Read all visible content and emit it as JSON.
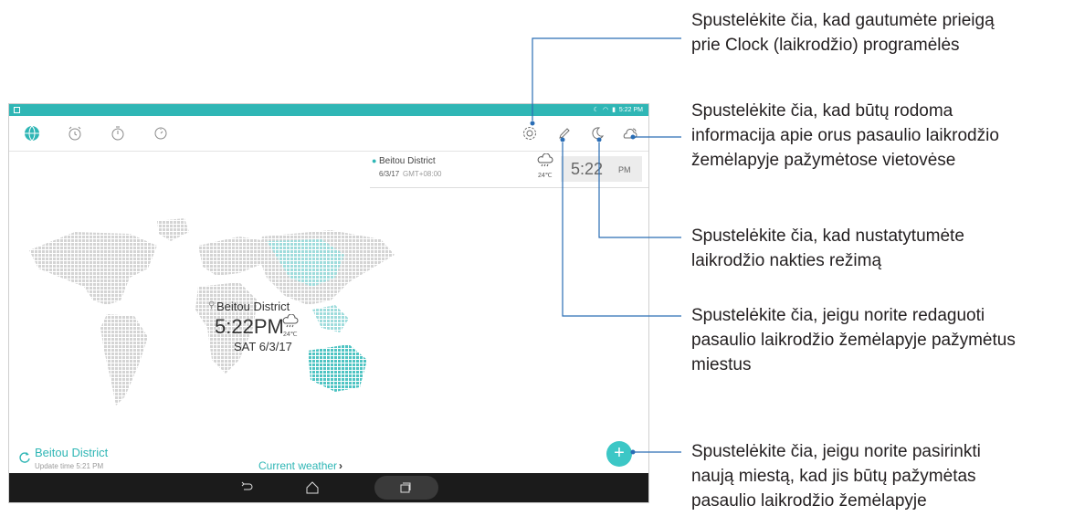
{
  "status_bar": {
    "time": "5:22 PM"
  },
  "toolbar": {
    "left_tabs": [
      "world-clock-icon",
      "alarm-icon",
      "stopwatch-icon",
      "timer-icon"
    ],
    "right_actions": [
      "settings-icon",
      "edit-icon",
      "night-mode-icon",
      "weather-icon"
    ]
  },
  "city_card": {
    "name": "Beitou District",
    "date": "6/3/17",
    "timezone": "GMT+08:00",
    "temperature": "24℃",
    "time": "5:22",
    "ampm": "PM"
  },
  "map_marker": {
    "name": "Beitou District",
    "time": "5:22PM",
    "temperature": "24℃",
    "date": "SAT 6/3/17"
  },
  "footer": {
    "location": "Beitou District",
    "update_time": "Update time 5:21 PM",
    "current_weather": "Current weather"
  },
  "callouts": {
    "settings": [
      "Spustelėkite čia, kad gautumėte prieigą",
      "prie Clock (laikrodžio) programėlės"
    ],
    "weather": [
      "Spustelėkite čia, kad būtų rodoma",
      "informacija apie orus pasaulio laikrodžio",
      "žemėlapyje pažymėtose vietovėse"
    ],
    "night_mode": [
      "Spustelėkite čia, kad nustatytumėte",
      "laikrodžio nakties režimą"
    ],
    "edit": [
      "Spustelėkite čia, jeigu norite redaguoti",
      "pasaulio laikrodžio žemėlapyje pažymėtus",
      "miestus"
    ],
    "add_city": [
      "Spustelėkite čia, jeigu norite pasirinkti",
      "naują miestą, kad jis būtų pažymėtas",
      "pasaulio laikrodžio žemėlapyje"
    ]
  },
  "colors": {
    "accent": "#2fb6b5",
    "leader_line": "#2a6db5",
    "text": "#231f20"
  }
}
